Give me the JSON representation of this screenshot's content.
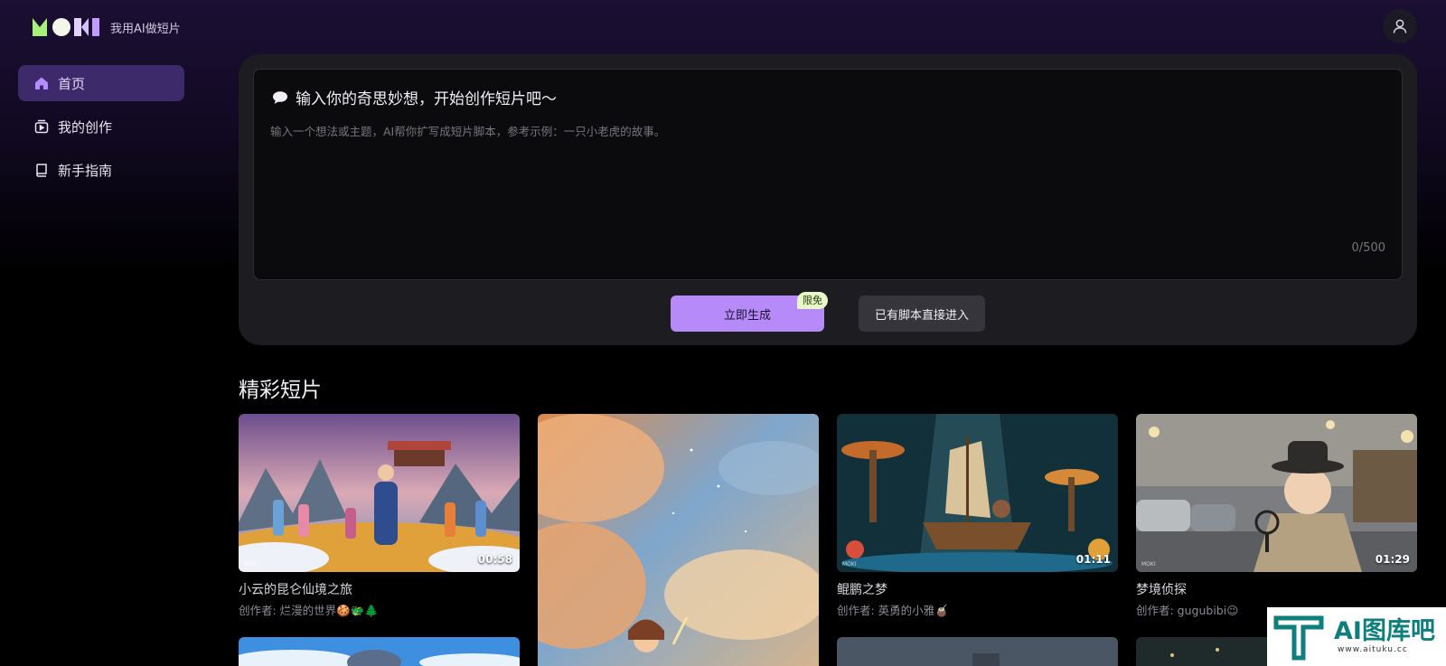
{
  "app": {
    "logo_text": "MOKI",
    "tagline": "我用AI做短片"
  },
  "sidebar": {
    "items": [
      {
        "label": "首页",
        "icon": "home-icon",
        "active": true
      },
      {
        "label": "我的创作",
        "icon": "creation-icon",
        "active": false
      },
      {
        "label": "新手指南",
        "icon": "book-icon",
        "active": false
      }
    ]
  },
  "prompt": {
    "title": "输入你的奇思妙想，开始创作短片吧～",
    "placeholder": "输入一个想法或主题，AI帮你扩写成短片脚本，参考示例：一只小老虎的故事。",
    "char_count": "0/500",
    "generate_label": "立即生成",
    "free_badge": "限免",
    "script_label": "已有脚本直接进入"
  },
  "gallery": {
    "title": "精彩短片",
    "cards": [
      {
        "title": "小云的昆仑仙境之旅",
        "author": "创作者: 烂漫的世界🍪🐲🌲",
        "duration": "00:58"
      },
      {
        "title": "",
        "author": "",
        "duration": ""
      },
      {
        "title": "鲲鹏之梦",
        "author": "创作者: 英勇的小雅🧉",
        "duration": "01:11"
      },
      {
        "title": "梦境侦探",
        "author": "创作者: gugubibi😉",
        "duration": "01:29"
      }
    ]
  },
  "watermark": {
    "text": "AI图库吧",
    "url": "www.aituku.cc"
  },
  "colors": {
    "accent": "#b68af8",
    "active_nav": "#3d2a6b",
    "panel": "#1d1c21",
    "badge": "#e7f7c8"
  }
}
